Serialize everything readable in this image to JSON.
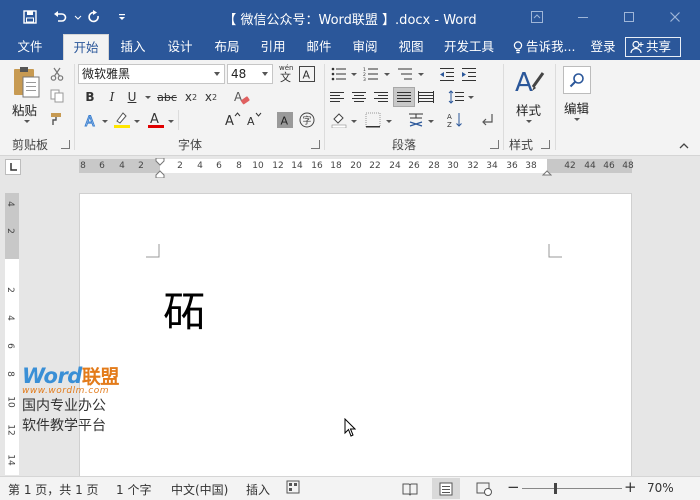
{
  "titlebar": {
    "title": "【 微信公众号：Word联盟 】.docx - Word",
    "qa_icons": [
      "save-icon",
      "undo-icon",
      "redo-icon",
      "customize-icon"
    ]
  },
  "tabs": [
    {
      "label": "文件",
      "active": false
    },
    {
      "label": "开始",
      "active": true
    },
    {
      "label": "插入",
      "active": false
    },
    {
      "label": "设计",
      "active": false
    },
    {
      "label": "布局",
      "active": false
    },
    {
      "label": "引用",
      "active": false
    },
    {
      "label": "邮件",
      "active": false
    },
    {
      "label": "审阅",
      "active": false
    },
    {
      "label": "视图",
      "active": false
    },
    {
      "label": "开发工具",
      "active": false
    }
  ],
  "tell_me": "告诉我...",
  "login": "登录",
  "share": "共享",
  "ribbon": {
    "clipboard": {
      "label": "剪贴板",
      "paste": "粘贴"
    },
    "font": {
      "label": "字体",
      "font_name": "微软雅黑",
      "font_size": "48",
      "wen": "wén"
    },
    "paragraph": {
      "label": "段落"
    },
    "styles": {
      "label": "样式",
      "button": "样式"
    },
    "editing": {
      "button": "编辑"
    }
  },
  "ruler": {
    "left_numbers": [
      "8",
      "6",
      "4",
      "2"
    ],
    "right_numbers": [
      "2",
      "4",
      "6",
      "8",
      "10",
      "12",
      "14",
      "16",
      "18",
      "20",
      "22",
      "24",
      "26",
      "28",
      "30",
      "32",
      "34",
      "36",
      "38"
    ],
    "margin_numbers": [
      "42",
      "44",
      "46",
      "48"
    ]
  },
  "vruler": {
    "numbers": [
      "4",
      "2",
      "2",
      "4",
      "6",
      "8",
      "10",
      "12",
      "14"
    ]
  },
  "document": {
    "text": "砳"
  },
  "watermark": {
    "brand_en": "Word",
    "brand_cn": "联盟",
    "url": "www.wordlm.com",
    "line1": "国内专业办公",
    "line2": "软件教学平台"
  },
  "statusbar": {
    "page": "第 1 页，共 1 页",
    "words": "1 个字",
    "language": "中文(中国)",
    "mode": "插入",
    "zoom": "70%",
    "zoom_level": 0.33
  }
}
